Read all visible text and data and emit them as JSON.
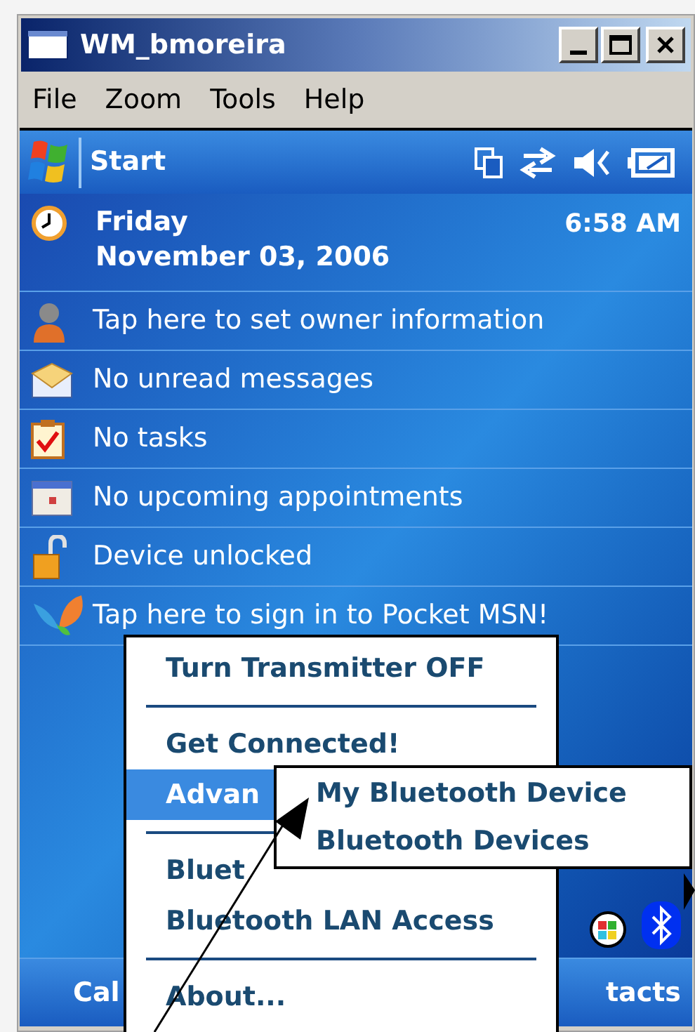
{
  "window": {
    "title": "WM_bmoreira"
  },
  "menu_bar": [
    "File",
    "Zoom",
    "Tools",
    "Help"
  ],
  "start_bar": {
    "label": "Start"
  },
  "today": {
    "day": "Friday",
    "date": "November 03, 2006",
    "time": "6:58 AM",
    "items": [
      {
        "kind": "owner",
        "text": "Tap here to set owner information"
      },
      {
        "kind": "messages",
        "text": "No unread messages"
      },
      {
        "kind": "tasks",
        "text": "No tasks"
      },
      {
        "kind": "calendar",
        "text": "No upcoming appointments"
      },
      {
        "kind": "lock",
        "text": "Device unlocked"
      },
      {
        "kind": "msn",
        "text": "Tap here to sign in to Pocket MSN!"
      }
    ]
  },
  "softkeys": [
    "Cal",
    "tacts"
  ],
  "context_menu": {
    "items": [
      {
        "kind": "item",
        "text": "Turn Transmitter OFF",
        "selected": false
      },
      {
        "kind": "separator"
      },
      {
        "kind": "item",
        "text": "Get Connected!",
        "selected": false
      },
      {
        "kind": "item",
        "text": "Advan",
        "selected": true
      },
      {
        "kind": "separator"
      },
      {
        "kind": "item",
        "text": "Bluet",
        "selected": false
      },
      {
        "kind": "item",
        "text": "Bluetooth LAN Access",
        "selected": false
      },
      {
        "kind": "separator"
      },
      {
        "kind": "item",
        "text": "About...",
        "selected": false
      }
    ]
  },
  "submenu": {
    "items": [
      {
        "text": "My Bluetooth Device",
        "selected": false
      },
      {
        "text": "Bluetooth Devices",
        "selected": false
      }
    ]
  }
}
